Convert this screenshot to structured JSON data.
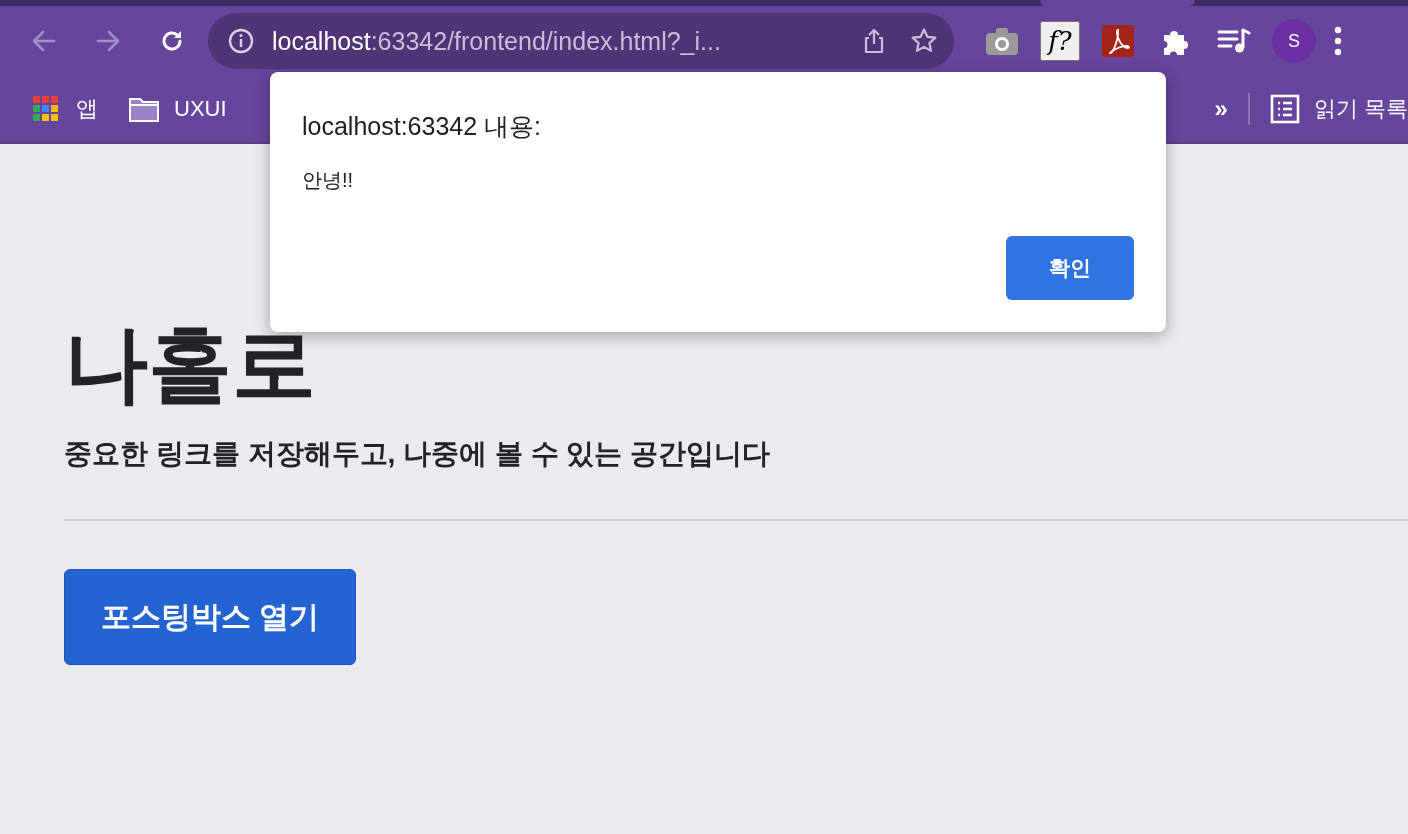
{
  "browser": {
    "nav_buttons": [
      {
        "kind": "back",
        "disabled": true
      },
      {
        "kind": "forward",
        "disabled": true
      },
      {
        "kind": "reload",
        "disabled": false
      }
    ],
    "address": {
      "host": "localhost",
      "rest": ":63342/frontend/index.html?_i..."
    },
    "extensions": [
      {
        "kind": "camera"
      },
      {
        "kind": "formula",
        "label": "f?"
      },
      {
        "kind": "pdf"
      },
      {
        "kind": "puzzle"
      },
      {
        "kind": "playlist"
      }
    ],
    "profile": {
      "initial": "S"
    },
    "bookmarks": [
      {
        "kind": "apps",
        "label": "앱"
      },
      {
        "kind": "folder",
        "label": "UXUI"
      }
    ],
    "bookmarks_overflow": "»",
    "reading_list": "읽기 목록"
  },
  "page": {
    "heading": "나홀로",
    "subtitle": "중요한 링크를 저장해두고, 나중에 볼 수 있는 공간입니다",
    "button": "포스팅박스 열기"
  },
  "dialog": {
    "title": "localhost:63342 내용:",
    "message": "안녕!!",
    "ok_button": "확인"
  }
}
